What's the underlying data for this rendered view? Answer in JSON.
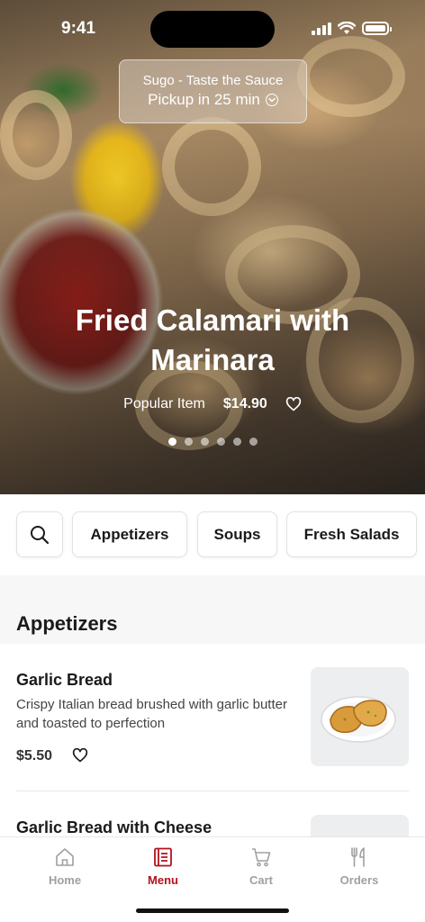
{
  "status_bar": {
    "time": "9:41"
  },
  "restaurant": {
    "name": "Sugo - Taste the Sauce",
    "pickup": "Pickup in 25 min"
  },
  "hero": {
    "title": "Fried Calamari with Marinara",
    "badge": "Popular Item",
    "price": "$14.90",
    "slide_count": 6,
    "active_slide": 1
  },
  "categories": [
    "Appetizers",
    "Soups",
    "Fresh Salads"
  ],
  "section": {
    "title": "Appetizers"
  },
  "menu_items": [
    {
      "name": "Garlic Bread",
      "description": "Crispy Italian bread brushed with garlic butter and toasted to perfection",
      "price": "$5.50"
    },
    {
      "name": "Garlic Bread with Cheese"
    }
  ],
  "tabs": [
    {
      "label": "Home",
      "icon": "home-icon",
      "active": false
    },
    {
      "label": "Menu",
      "icon": "menu-icon",
      "active": true
    },
    {
      "label": "Cart",
      "icon": "cart-icon",
      "active": false
    },
    {
      "label": "Orders",
      "icon": "fork-knife-icon",
      "active": false
    }
  ],
  "colors": {
    "accent": "#b3121d",
    "inactive": "#a0a0a0"
  }
}
